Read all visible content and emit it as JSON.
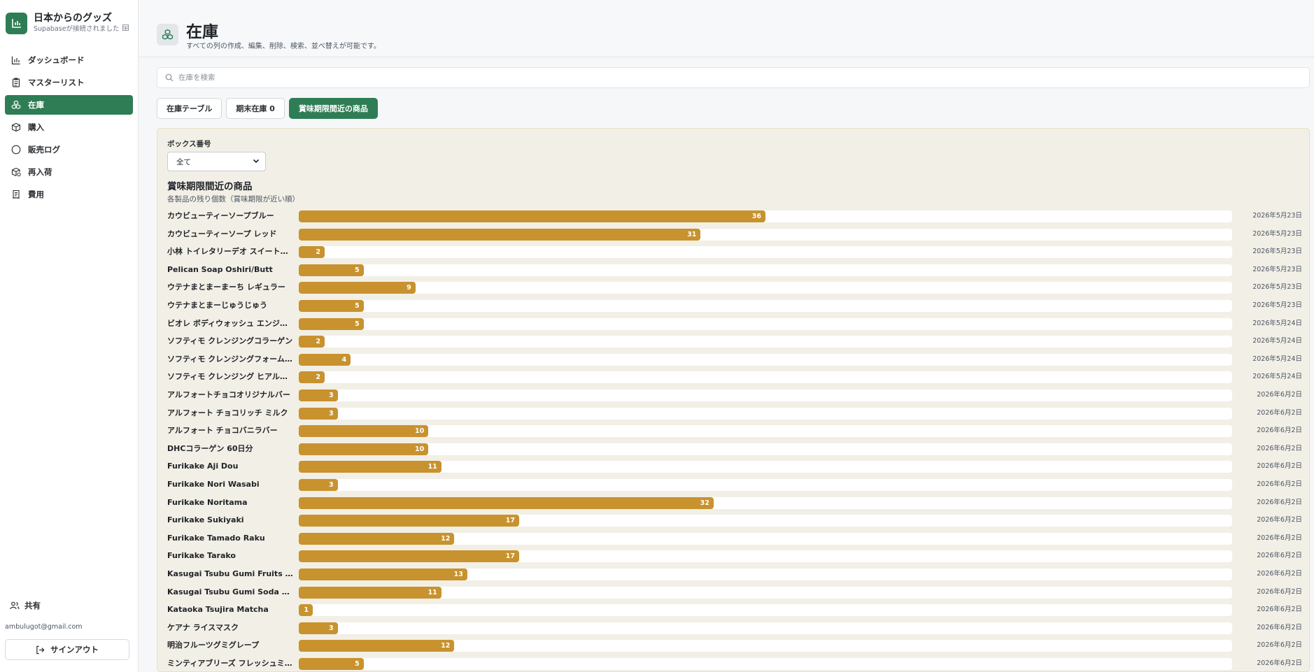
{
  "brand": {
    "title": "日本からのグッズ",
    "subtitle": "Supabaseが接続されました",
    "color": "#2e7d55"
  },
  "sidebar": {
    "items": [
      {
        "label": "ダッシュボード",
        "icon": "bar-chart-icon",
        "active": false
      },
      {
        "label": "マスターリスト",
        "icon": "clipboard-icon",
        "active": false
      },
      {
        "label": "在庫",
        "icon": "boxes-icon",
        "active": true
      },
      {
        "label": "購入",
        "icon": "package-icon",
        "active": false
      },
      {
        "label": "販売ログ",
        "icon": "dollar-circle-icon",
        "active": false
      },
      {
        "label": "再入荷",
        "icon": "package-refresh-icon",
        "active": false
      },
      {
        "label": "費用",
        "icon": "receipt-icon",
        "active": false
      }
    ],
    "share_label": "共有",
    "email": "ambulugot@gmail.com",
    "signout_label": "サインアウト"
  },
  "header": {
    "title": "在庫",
    "subtitle": "すべての列の作成、編集、削除、検索、並べ替えが可能です。"
  },
  "search": {
    "placeholder": "在庫を検索"
  },
  "tabs": [
    {
      "label": "在庫テーブル",
      "active": false
    },
    {
      "label": "期末在庫 0",
      "active": false
    },
    {
      "label": "賞味期限間近の商品",
      "active": true
    }
  ],
  "panel": {
    "box_label": "ボックス番号",
    "box_selected": "全て"
  },
  "chart_data": {
    "type": "bar",
    "orientation": "horizontal",
    "title": "賞味期限間近の商品",
    "subtitle": "各製品の残り個数（賞味期限が近い順）",
    "xlim": [
      0,
      72
    ],
    "bar_color": "#c8922e",
    "rows": [
      {
        "label": "カウビューティーソープブルー",
        "value": 36,
        "date": "2026年5月23日"
      },
      {
        "label": "カウビューティーソープ レッド",
        "value": 31,
        "date": "2026年5月23日"
      },
      {
        "label": "小林 トイレタリーデオ スイートフローラル",
        "value": 2,
        "date": "2026年5月23日"
      },
      {
        "label": "Pelican Soap Oshiri/Butt",
        "value": 5,
        "date": "2026年5月23日"
      },
      {
        "label": "ウテナまとまーまーち レギュラー",
        "value": 9,
        "date": "2026年5月23日"
      },
      {
        "label": "ウテナまとまーじゅうじゅう",
        "value": 5,
        "date": "2026年5月23日"
      },
      {
        "label": "ビオレ ボディウォッシュ エンジェルローズ",
        "value": 5,
        "date": "2026年5月24日"
      },
      {
        "label": "ソフティモ クレンジングコラーゲン",
        "value": 2,
        "date": "2026年5月24日"
      },
      {
        "label": "ソフティモ クレンジングフォームビタミン",
        "value": 4,
        "date": "2026年5月24日"
      },
      {
        "label": "ソフティモ クレンジング ヒアルロン酸",
        "value": 2,
        "date": "2026年5月24日"
      },
      {
        "label": "アルフォートチョコオリジナルバー",
        "value": 3,
        "date": "2026年6月2日"
      },
      {
        "label": "アルフォート チョコリッチ ミルク",
        "value": 3,
        "date": "2026年6月2日"
      },
      {
        "label": "アルフォート チョコバニラバー",
        "value": 10,
        "date": "2026年6月2日"
      },
      {
        "label": "DHCコラーゲン 60日分",
        "value": 10,
        "date": "2026年6月2日"
      },
      {
        "label": "Furikake Aji Dou",
        "value": 11,
        "date": "2026年6月2日"
      },
      {
        "label": "Furikake Nori Wasabi",
        "value": 3,
        "date": "2026年6月2日"
      },
      {
        "label": "Furikake Noritama",
        "value": 32,
        "date": "2026年6月2日"
      },
      {
        "label": "Furikake Sukiyaki",
        "value": 17,
        "date": "2026年6月2日"
      },
      {
        "label": "Furikake Tamado Raku",
        "value": 12,
        "date": "2026年6月2日"
      },
      {
        "label": "Furikake Tarako",
        "value": 17,
        "date": "2026年6月2日"
      },
      {
        "label": "Kasugai Tsubu Gumi Fruits Mix",
        "value": 13,
        "date": "2026年6月2日"
      },
      {
        "label": "Kasugai Tsubu Gumi Soda Mix",
        "value": 11,
        "date": "2026年6月2日"
      },
      {
        "label": "Kataoka Tsujira Matcha",
        "value": 1,
        "date": "2026年6月2日"
      },
      {
        "label": "ケアナ ライスマスク",
        "value": 3,
        "date": "2026年6月2日"
      },
      {
        "label": "明治フルーツグミグレープ",
        "value": 12,
        "date": "2026年6月2日"
      },
      {
        "label": "ミンティアブリーズ フレッシュミント",
        "value": 5,
        "date": "2026年6月2日"
      }
    ]
  }
}
